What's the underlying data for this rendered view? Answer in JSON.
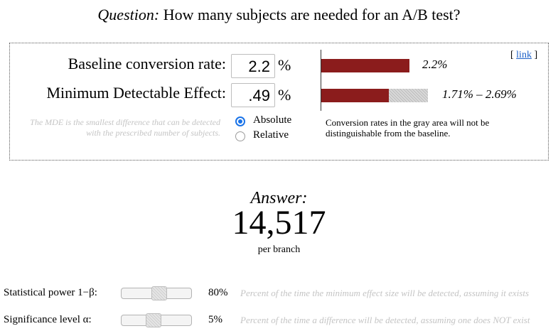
{
  "title": {
    "prefix": "Question:",
    "text": "How many subjects are needed for an A/B test?"
  },
  "inputs": {
    "baseline": {
      "label": "Baseline conversion rate:",
      "value": "2.2",
      "unit": "%"
    },
    "mde": {
      "label": "Minimum Detectable Effect:",
      "value": ".49",
      "unit": "%"
    }
  },
  "hint": "The MDE is the smallest difference that can be detected with the prescribed number of subjects.",
  "mde_mode": {
    "options": [
      "Absolute",
      "Relative"
    ],
    "selected": "Absolute"
  },
  "link": {
    "open": "[ ",
    "text": "link",
    "close": " ]"
  },
  "bars": {
    "baseline_label": "2.2%",
    "range_label": "1.71% – 2.69%",
    "note": "Conversion rates in the gray area will not be distinguishable from the baseline."
  },
  "answer": {
    "label": "Answer:",
    "value": "14,517",
    "unit": "per branch"
  },
  "sliders": {
    "power": {
      "label": "Statistical power 1−β:",
      "value": "80%",
      "level": 0.55,
      "description": "Percent of the time the minimum effect size will be detected, assuming it exists"
    },
    "significance": {
      "label": "Significance level α:",
      "value": "5%",
      "level": 0.45,
      "description": "Percent of the time a difference will be detected, assuming one does NOT exist"
    }
  },
  "colors": {
    "bar": "#8b1c1c",
    "radio_accent": "#1a73e8",
    "link": "#1a5fc8",
    "hint_text": "#c4c4c4"
  }
}
